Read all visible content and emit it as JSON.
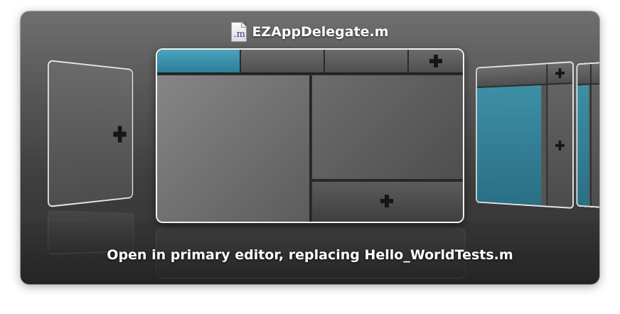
{
  "header": {
    "file_icon_ext": ".m",
    "file_name": "EZAppDelegate.m"
  },
  "message": "Open in primary editor, replacing Hello_WorldTests.m",
  "colors": {
    "accent_tab": "#3a92ad",
    "panel_dark": "#303030",
    "text": "#ffffff"
  },
  "icons": {
    "add": "plus-icon",
    "file": "objc-source-file-icon"
  }
}
